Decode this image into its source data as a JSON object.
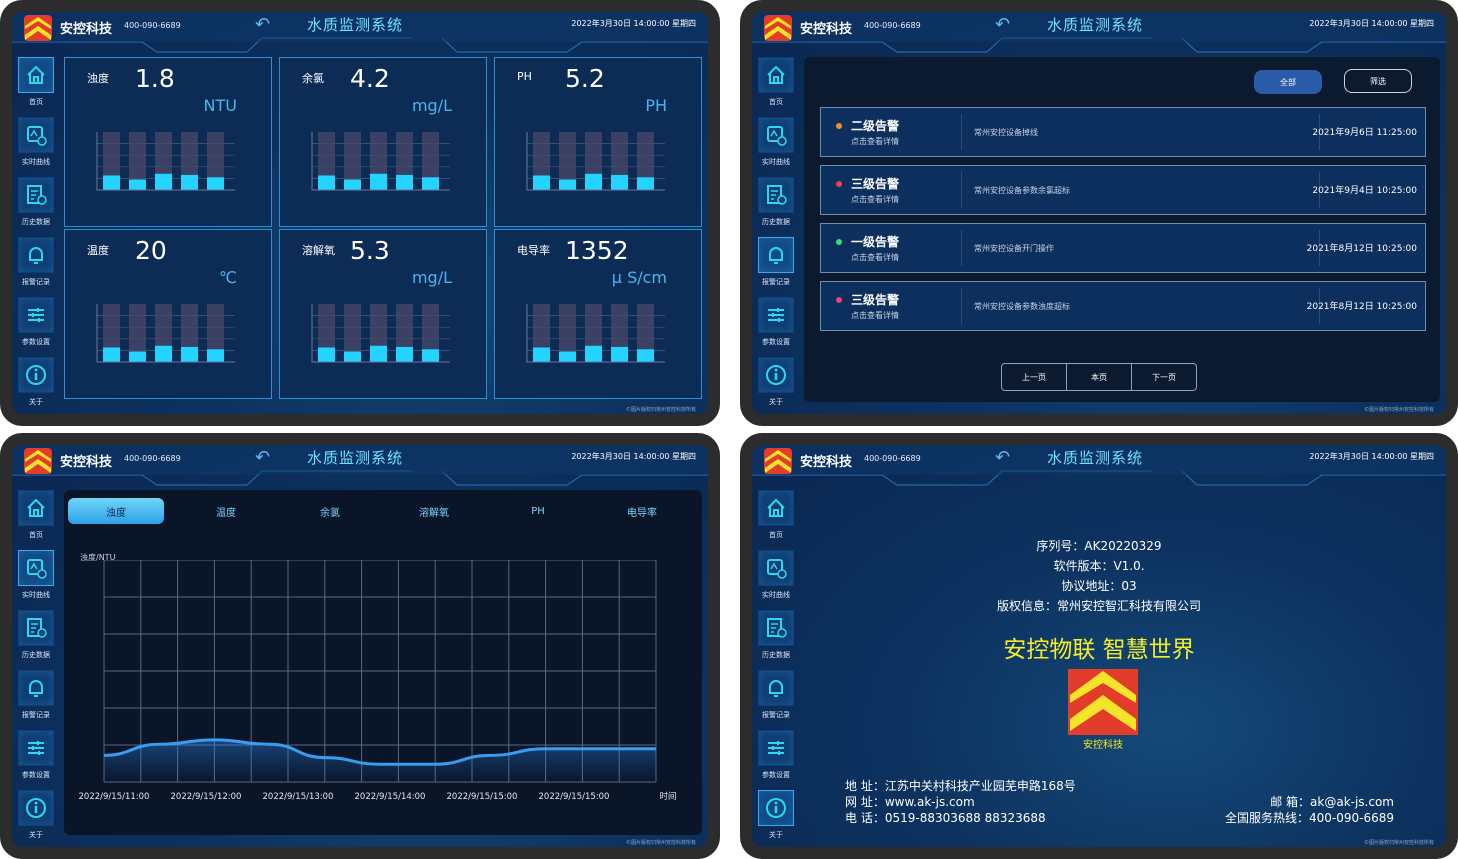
{
  "common": {
    "brand": "安控科技",
    "hotline": "400-090-6689",
    "system_title": "水质监测系统",
    "datetime": "2022年3月30日 14:00:00 星期四",
    "footer": "©图片版权归常州安控科技所有",
    "nav": [
      {
        "label": "首页",
        "icon": "home-icon"
      },
      {
        "label": "实时曲线",
        "icon": "realtime-curve-icon"
      },
      {
        "label": "历史数据",
        "icon": "history-data-icon"
      },
      {
        "label": "报警记录",
        "icon": "bell-icon"
      },
      {
        "label": "参数设置",
        "icon": "sliders-icon"
      },
      {
        "label": "关于",
        "icon": "info-icon"
      }
    ],
    "colors": {
      "accent": "#6fe3ff",
      "bar": "#22d4ff",
      "bar_bg": "#4a4a6a",
      "panel": "#0a2650",
      "logo_red": "#e23c2a",
      "logo_yellow": "#f5e52a"
    }
  },
  "dashboard": {
    "cards": [
      {
        "name": "浊度",
        "value": "1.8",
        "unit": "NTU",
        "bars": [
          0.25,
          0.18,
          0.28,
          0.26,
          0.22
        ]
      },
      {
        "name": "余氯",
        "value": "4.2",
        "unit": "mg/L",
        "bars": [
          0.25,
          0.18,
          0.28,
          0.26,
          0.22
        ]
      },
      {
        "name": "PH",
        "value": "5.2",
        "unit": "PH",
        "bars": [
          0.25,
          0.18,
          0.28,
          0.26,
          0.22
        ]
      },
      {
        "name": "温度",
        "value": "20",
        "unit": "℃",
        "bars": [
          0.25,
          0.18,
          0.28,
          0.26,
          0.22
        ]
      },
      {
        "name": "溶解氧",
        "value": "5.3",
        "unit": "mg/L",
        "bars": [
          0.25,
          0.18,
          0.28,
          0.26,
          0.22
        ]
      },
      {
        "name": "电导率",
        "value": "1352",
        "unit": "μ S/cm",
        "bars": [
          0.25,
          0.18,
          0.28,
          0.26,
          0.22
        ]
      }
    ]
  },
  "alarms": {
    "btn_all": "全部",
    "btn_filter": "筛选",
    "items": [
      {
        "level": "二级告警",
        "hint": "点击查看详情",
        "desc": "常州安控设备掉线",
        "time": "2021年9月6日 11:25:00",
        "color": "#f0902a"
      },
      {
        "level": "三级告警",
        "hint": "点击查看详情",
        "desc": "常州安控设备参数余氯超标",
        "time": "2021年9月4日 10:25:00",
        "color": "#f04050"
      },
      {
        "level": "一级告警",
        "hint": "点击查看详情",
        "desc": "常州安控设备开门操作",
        "time": "2021年8月12日 10:25:00",
        "color": "#30e080"
      },
      {
        "level": "三级告警",
        "hint": "点击查看详情",
        "desc": "常州安控设备参数浊度超标",
        "time": "2021年8月12日 10:25:00",
        "color": "#f04070"
      }
    ],
    "pager": {
      "prev": "上一页",
      "current": "本页",
      "next": "下一页"
    }
  },
  "trend": {
    "tabs": [
      "浊度",
      "温度",
      "余氯",
      "溶解氧",
      "PH",
      "电导率"
    ],
    "chart_data": {
      "type": "line",
      "title": "",
      "ylabel": "浊度/NTU",
      "xlabel": "时间",
      "x": [
        "2022/9/15/11:00",
        "2022/9/15/12:00",
        "2022/9/15/13:00",
        "2022/9/15/14:00",
        "2022/9/15/15:00",
        "2022/9/15/15:00"
      ],
      "series": [
        {
          "name": "浊度",
          "values": [
            0.12,
            0.17,
            0.19,
            0.17,
            0.11,
            0.08,
            0.08,
            0.12,
            0.15,
            0.15,
            0.15
          ]
        }
      ],
      "ylim": [
        0,
        1
      ],
      "grid": true
    }
  },
  "about": {
    "serial": "序列号：AK20220329",
    "version": "软件版本：V1.0.",
    "protocol": "协议地址：03",
    "copyright": "版权信息：常州安控智汇科技有限公司",
    "slogan": "安控物联  智慧世界",
    "logo_text": "安控科技",
    "address_label": "地      址：",
    "address": "江苏中关村科技产业园芜申路168号",
    "web_label": "网      址：",
    "web": "www.ak-js.com",
    "tel_label": "电      话：",
    "tel": "0519-88303688  88323688",
    "email_label": "邮      箱：",
    "email": "ak@ak-js.com",
    "service_label": "全国服务热线：",
    "service": "400-090-6689"
  }
}
